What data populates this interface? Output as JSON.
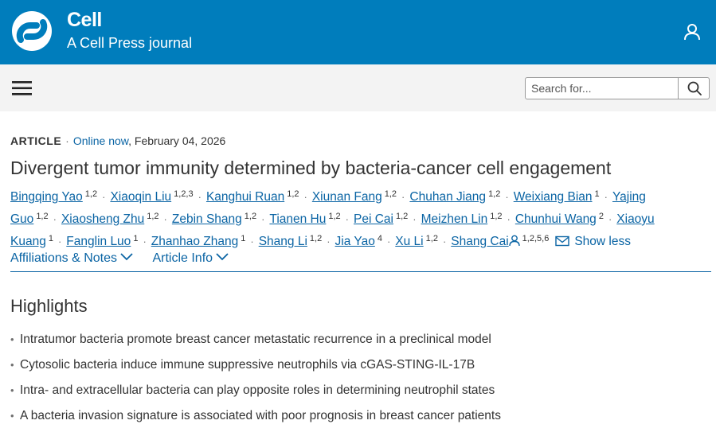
{
  "header": {
    "brand_name": "Cell",
    "brand_subtitle": "A Cell Press journal",
    "colors": {
      "brand_blue": "#007dbc",
      "link_blue": "#0a64a4",
      "nav_bg": "#f3f3f3"
    },
    "icons": [
      "cell-logo",
      "user-icon"
    ]
  },
  "nav": {
    "menu_icon": "hamburger-menu-icon",
    "search_placeholder": "Search for...",
    "search_icon": "search-icon"
  },
  "article": {
    "type": "ARTICLE",
    "status": "Online now",
    "date": ", February 04, 2026",
    "separator": "·",
    "title": "Divergent tumor immunity determined by bacteria-cancer cell engagement",
    "authors": [
      {
        "name": "Bingqing Yao",
        "aff": "1,2"
      },
      {
        "name": "Xiaoqin Liu",
        "aff": "1,2,3"
      },
      {
        "name": "Kanghui Ruan",
        "aff": "1,2"
      },
      {
        "name": "Xiunan Fang",
        "aff": "1,2"
      },
      {
        "name": "Chuhan Jiang",
        "aff": "1,2"
      },
      {
        "name": "Weixiang Bian",
        "aff": "1"
      },
      {
        "name": "Yajing Guo",
        "aff": "1,2"
      },
      {
        "name": "Xiaosheng Zhu",
        "aff": "1,2"
      },
      {
        "name": "Zebin Shang",
        "aff": "1,2"
      },
      {
        "name": "Tianen Hu",
        "aff": "1,2"
      },
      {
        "name": "Pei Cai",
        "aff": "1,2"
      },
      {
        "name": "Meizhen Lin",
        "aff": "1,2"
      },
      {
        "name": "Chunhui Wang",
        "aff": "2"
      },
      {
        "name": "Xiaoyu Kuang",
        "aff": "1"
      },
      {
        "name": "Fanglin Luo",
        "aff": "1"
      },
      {
        "name": "Zhanhao Zhang",
        "aff": "1"
      },
      {
        "name": "Shang Li",
        "aff": "1,2"
      },
      {
        "name": "Jia Yao",
        "aff": "4"
      },
      {
        "name": "Xu Li",
        "aff": "1,2"
      },
      {
        "name": "Shang Cai",
        "aff": "1,2,5,6",
        "corresponding": true
      }
    ],
    "show_less_label": "Show less",
    "tabs": [
      {
        "label": "Affiliations & Notes"
      },
      {
        "label": "Article Info"
      }
    ]
  },
  "highlights": {
    "heading": "Highlights",
    "bullet": "•",
    "items": [
      "Intratumor bacteria promote breast cancer metastatic recurrence in a preclinical model",
      "Cytosolic bacteria induce immune suppressive neutrophils via cGAS-STING-IL-17B",
      "Intra- and extracellular bacteria can play opposite roles in determining neutrophil states",
      "A bacteria invasion signature is associated with poor prognosis in breast cancer patients"
    ]
  }
}
